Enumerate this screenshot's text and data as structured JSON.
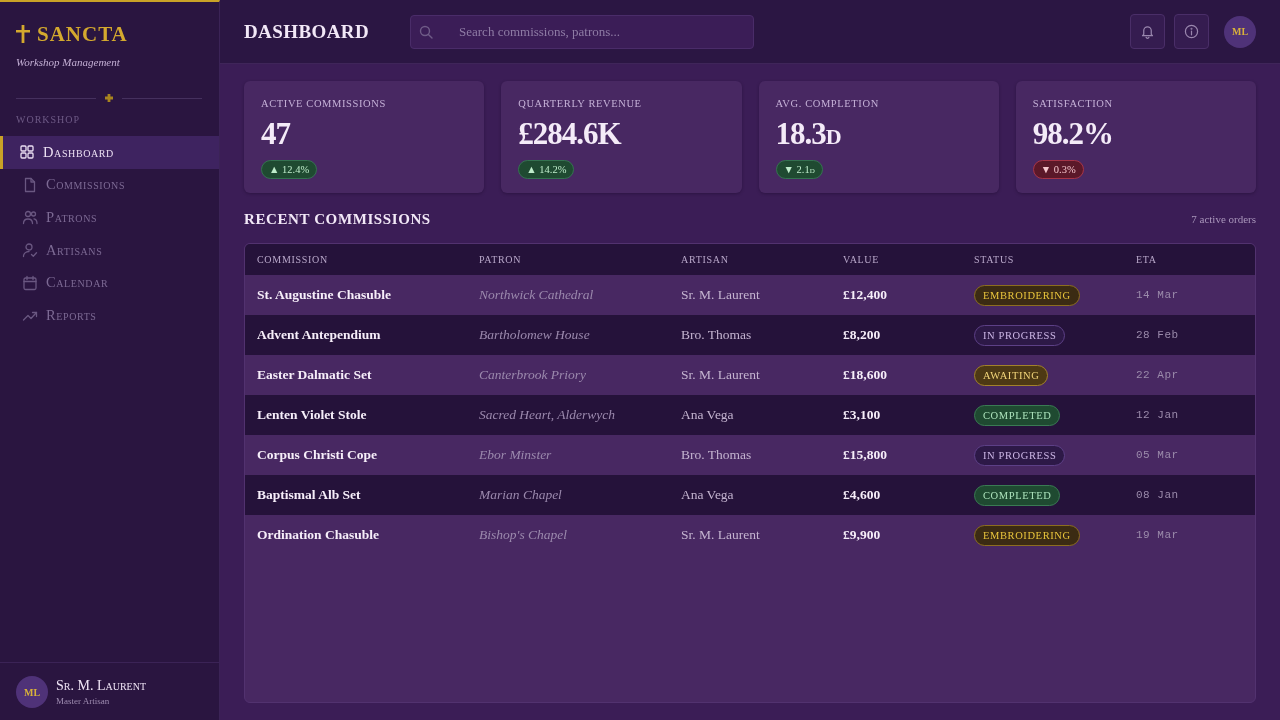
{
  "sidebar": {
    "brand": "SANCTA",
    "tagline": "Workshop Management",
    "section_label": "WORKSHOP",
    "items": [
      {
        "label": "Dashboard",
        "selected": true
      },
      {
        "label": "Commissions",
        "selected": false
      },
      {
        "label": "Patrons",
        "selected": false
      },
      {
        "label": "Artisans",
        "selected": false
      },
      {
        "label": "Calendar",
        "selected": false
      },
      {
        "label": "Reports",
        "selected": false
      }
    ],
    "user": {
      "initials": "ML",
      "name": "Sr. M. Laurent",
      "role": "Master Artisan"
    }
  },
  "header": {
    "title": "DASHBOARD",
    "search": {
      "placeholder": "Search commissions, patrons..."
    },
    "avatar_initials": "ML"
  },
  "stats": [
    {
      "label": "ACTIVE COMMISSIONS",
      "value": "47",
      "delta": "▲ 12.4%",
      "kind": "positive"
    },
    {
      "label": "QUARTERLY REVENUE",
      "value": "£284.6K",
      "delta": "▲ 14.2%",
      "kind": "positive"
    },
    {
      "label": "AVG. COMPLETION",
      "value": "18.3d",
      "delta": "▼ 2.1d",
      "kind": "positive"
    },
    {
      "label": "SATISFACTION",
      "value": "98.2%",
      "delta": "▼ 0.3%",
      "kind": "negative"
    }
  ],
  "recent": {
    "title": "RECENT COMMISSIONS",
    "count": "7 active orders",
    "table": {
      "columns": [
        "COMMISSION",
        "PATRON",
        "ARTISAN",
        "VALUE",
        "STATUS",
        "ETA"
      ],
      "rows": [
        {
          "commission": "St. Augustine Chasuble",
          "patron": "Northwick Cathedral",
          "artisan": "Sr. M. Laurent",
          "value": "£12,400",
          "status": {
            "label": "EMBROIDERING",
            "kind": "embroidering"
          },
          "eta": "14 Mar"
        },
        {
          "commission": "Advent Antependium",
          "patron": "Bartholomew House",
          "artisan": "Bro. Thomas",
          "value": "£8,200",
          "status": {
            "label": "IN PROGRESS",
            "kind": "progress"
          },
          "eta": "28 Feb"
        },
        {
          "commission": "Easter Dalmatic Set",
          "patron": "Canterbrook Priory",
          "artisan": "Sr. M. Laurent",
          "value": "£18,600",
          "status": {
            "label": "AWAITING",
            "kind": "awaiting"
          },
          "eta": "22 Apr"
        },
        {
          "commission": "Lenten Violet Stole",
          "patron": "Sacred Heart, Alderwych",
          "artisan": "Ana Vega",
          "value": "£3,100",
          "status": {
            "label": "COMPLETED",
            "kind": "completed"
          },
          "eta": "12 Jan"
        },
        {
          "commission": "Corpus Christi Cope",
          "patron": "Ebor Minster",
          "artisan": "Bro. Thomas",
          "value": "£15,800",
          "status": {
            "label": "IN PROGRESS",
            "kind": "progress"
          },
          "eta": "05 Mar"
        },
        {
          "commission": "Baptismal Alb Set",
          "patron": "Marian Chapel",
          "artisan": "Ana Vega",
          "value": "£4,600",
          "status": {
            "label": "COMPLETED",
            "kind": "completed"
          },
          "eta": "08 Jan"
        },
        {
          "commission": "Ordination Chasuble",
          "patron": "Bishop's Chapel",
          "artisan": "Sr. M. Laurent",
          "value": "£9,900",
          "status": {
            "label": "EMBROIDERING",
            "kind": "embroidering"
          },
          "eta": "19 Mar"
        }
      ]
    }
  }
}
